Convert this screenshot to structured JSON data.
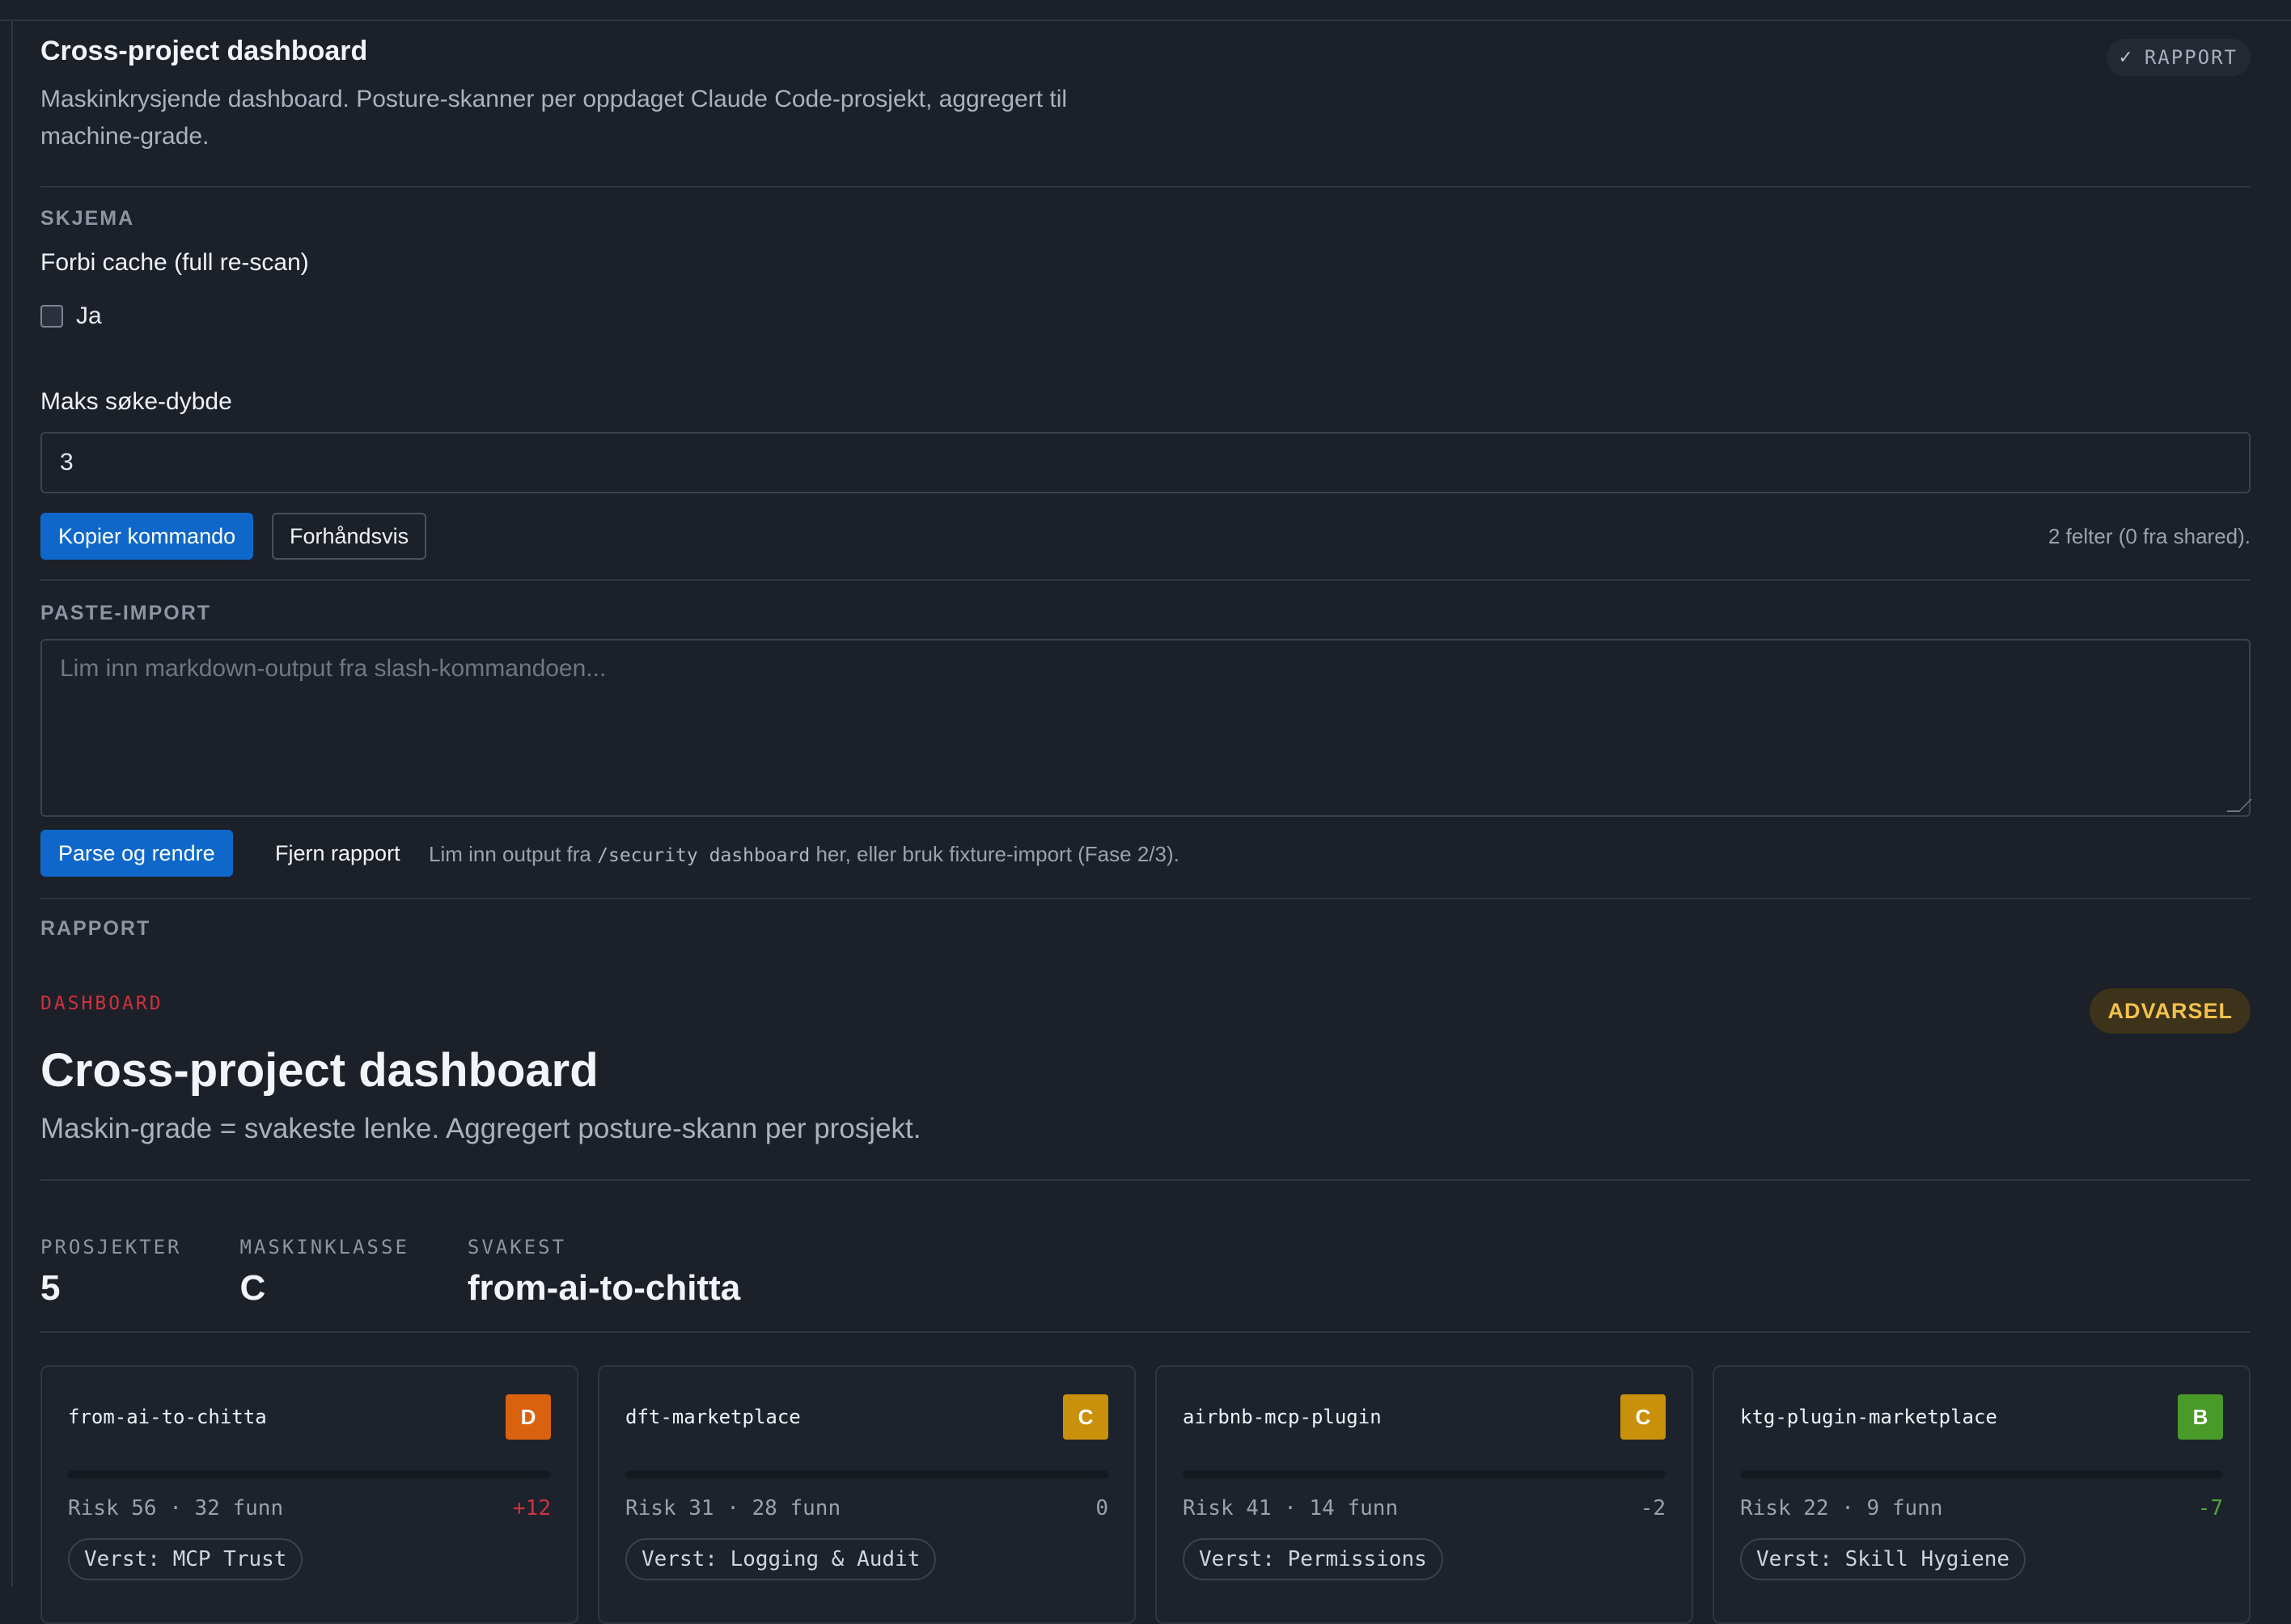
{
  "header": {
    "title": "Cross-project dashboard",
    "description": "Maskinkrysjende dashboard. Posture-skanner per oppdaget Claude Code-prosjekt, aggregert til machine-grade.",
    "chip_icon": "check-icon",
    "chip_label": "RAPPORT"
  },
  "schema": {
    "section_label": "SKJEMA",
    "bypass_cache_label": "Forbi cache (full re-scan)",
    "checkbox_label": "Ja",
    "checkbox_checked": false,
    "depth_label": "Maks søke-dybde",
    "depth_value": "3",
    "copy_button": "Kopier kommando",
    "preview_button": "Forhåndsvis",
    "fields_note": "2 felter (0 fra shared)."
  },
  "paste": {
    "section_label": "PASTE-IMPORT",
    "placeholder": "Lim inn markdown-output fra slash-kommandoen...",
    "parse_button": "Parse og rendre",
    "remove_button": "Fjern rapport",
    "hint_before": "Lim inn output fra",
    "hint_code": "/security dashboard",
    "hint_after": "her, eller bruk fixture-import (Fase 2/3)."
  },
  "report": {
    "section_label": "RAPPORT",
    "eyebrow": "DASHBOARD",
    "status_badge": "ADVARSEL",
    "title": "Cross-project dashboard",
    "subtitle": "Maskin-grade = svakeste lenke. Aggregert posture-skann per prosjekt.",
    "stats": {
      "projects_label": "PROSJEKTER",
      "projects_value": "5",
      "machine_class_label": "MASKINKLASSE",
      "machine_class_value": "C",
      "weakest_label": "SVAKEST",
      "weakest_value": "from-ai-to-chitta"
    },
    "projects": [
      {
        "name": "from-ai-to-chitta",
        "grade": "D",
        "grade_color": "#d9620f",
        "meta": "Risk 56 · 32 funn",
        "delta": "+12",
        "delta_color": "#d0313f",
        "worst": "Verst: MCP Trust"
      },
      {
        "name": "dft-marketplace",
        "grade": "C",
        "grade_color": "#c9900c",
        "meta": "Risk 31 · 28 funn",
        "delta": "0",
        "delta_color": "#9aa2ae",
        "worst": "Verst: Logging & Audit"
      },
      {
        "name": "airbnb-mcp-plugin",
        "grade": "C",
        "grade_color": "#c9900c",
        "meta": "Risk 41 · 14 funn",
        "delta": "-2",
        "delta_color": "#9aa2ae",
        "worst": "Verst: Permissions"
      },
      {
        "name": "ktg-plugin-marketplace",
        "grade": "B",
        "grade_color": "#4a9a2a",
        "meta": "Risk 22 · 9 funn",
        "delta": "-7",
        "delta_color": "#4fa83a",
        "worst": "Verst: Skill Hygiene"
      }
    ]
  }
}
